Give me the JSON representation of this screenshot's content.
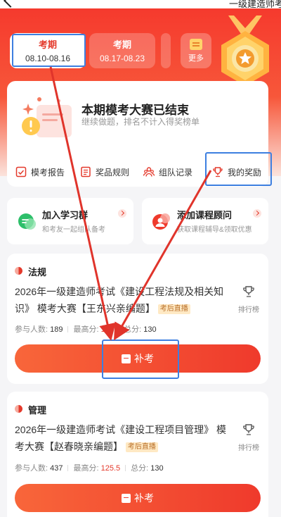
{
  "header": {
    "title": "一级建造师考",
    "back_icon": "chevron-left-icon"
  },
  "period_tabs": [
    {
      "name": "考期",
      "dates": "08.10-08.16",
      "active": true
    },
    {
      "name": "考期",
      "dates": "08.17-08.23",
      "active": false
    }
  ],
  "more_button": {
    "label": "更多",
    "icon": "calendar-icon"
  },
  "medal": {
    "icon": "star-medal-icon"
  },
  "status": {
    "title": "本期模考大赛已结束",
    "subtitle": "继续做题，排名不计入得奖榜单"
  },
  "quick_links": [
    {
      "label": "模考报告",
      "icon": "checklist-icon"
    },
    {
      "label": "奖品规则",
      "icon": "list-icon"
    },
    {
      "label": "组队记录",
      "icon": "team-icon"
    },
    {
      "label": "我的奖励",
      "icon": "trophy-icon"
    }
  ],
  "promos": [
    {
      "title": "加入学习群",
      "subtitle": "和考友一起组队备考",
      "icon": "chat-group-icon"
    },
    {
      "title": "添加课程顾问",
      "subtitle": "获取课程辅导&领取优惠",
      "icon": "advisor-icon"
    }
  ],
  "exams": [
    {
      "subject": "法规",
      "title": "2026年一级建造师考试《建设工程法规及相关知识》 模考大赛【王东兴亲编题】",
      "tag": "考后直播",
      "participants_label": "参与人数:",
      "participants": "189",
      "highest_label": "最高分:",
      "highest": "118",
      "total_label": "总分:",
      "total": "130",
      "rank_label": "排行榜",
      "button": "补考"
    },
    {
      "subject": "管理",
      "title": "2026年一级建造师考试《建设工程项目管理》 模考大赛【赵春晓亲编题】",
      "tag": "考后直播",
      "participants_label": "参与人数:",
      "participants": "437",
      "highest_label": "最高分:",
      "highest": "125.5",
      "total_label": "总分:",
      "total": "130",
      "rank_label": "排行榜",
      "button": "补考"
    }
  ],
  "colors": {
    "brand": "#e4392b",
    "highlight": "#3d7fe0",
    "arrow": "#e0342b"
  }
}
